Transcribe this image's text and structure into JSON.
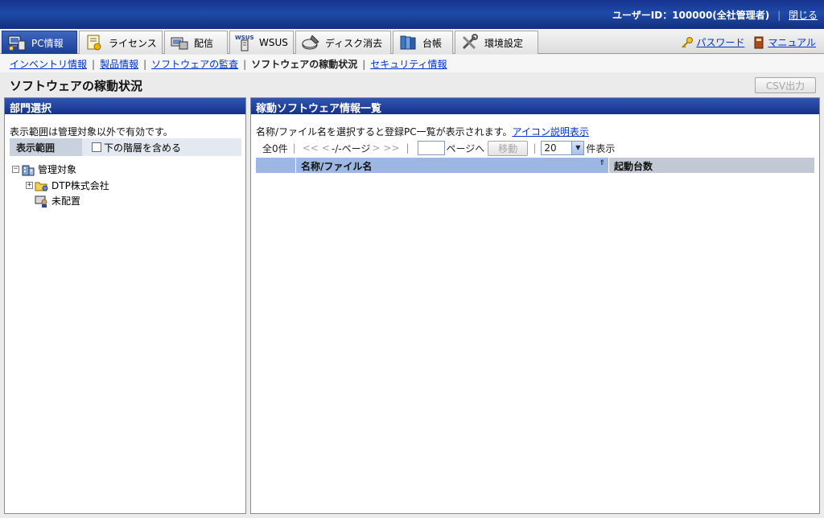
{
  "header": {
    "user_label": "ユーザーID：100000(全社管理者)",
    "close_label": "閉じる"
  },
  "tabs": [
    {
      "label": "PC情報",
      "icon": "pc-info-icon",
      "active": true
    },
    {
      "label": "ライセンス",
      "icon": "license-icon",
      "active": false
    },
    {
      "label": "配信",
      "icon": "distribution-icon",
      "active": false
    },
    {
      "label": "WSUS",
      "icon": "wsus-icon",
      "active": false
    },
    {
      "label": "ディスク消去",
      "icon": "disk-erase-icon",
      "active": false
    },
    {
      "label": "台帳",
      "icon": "ledger-icon",
      "active": false
    },
    {
      "label": "環境設定",
      "icon": "settings-tools-icon",
      "active": false
    }
  ],
  "toolbar_links": {
    "password": "パスワード",
    "manual": "マニュアル"
  },
  "subnav": {
    "items": [
      "インベントリ情報",
      "製品情報",
      "ソフトウェアの監査",
      "ソフトウェアの稼動状況",
      "セキュリティ情報"
    ],
    "current_index": 3
  },
  "page": {
    "title": "ソフトウェアの稼動状況",
    "csv_button": "CSV出力"
  },
  "left_panel": {
    "title": "部門選択",
    "note": "表示範囲は管理対象以外で有効です。",
    "scope_label": "表示範囲",
    "include_sublevels": "下の階層を含める",
    "tree": {
      "root": "管理対象",
      "child": "DTP株式会社",
      "unassigned": "未配置"
    }
  },
  "right_panel": {
    "title": "稼動ソフトウェア情報一覧",
    "note": "名称/ファイル名を選択すると登録PC一覧が表示されます。",
    "icon_help_link": "アイコン説明表示",
    "pager": {
      "total": "全0件",
      "first": "<<",
      "prev": "<",
      "page_info": "-/-ページ",
      "next": ">",
      "last": ">>",
      "page_to": "ページへ",
      "move_button": "移動",
      "per_page_value": "20",
      "per_page_suffix": "件表示"
    },
    "columns": [
      "名称/ファイル名",
      "起動台数"
    ]
  },
  "colors": {
    "header_blue": "#1f4aa8",
    "active_tab": "#2b51ad",
    "grid_header": "#9db7e4",
    "link": "#0033cc"
  }
}
